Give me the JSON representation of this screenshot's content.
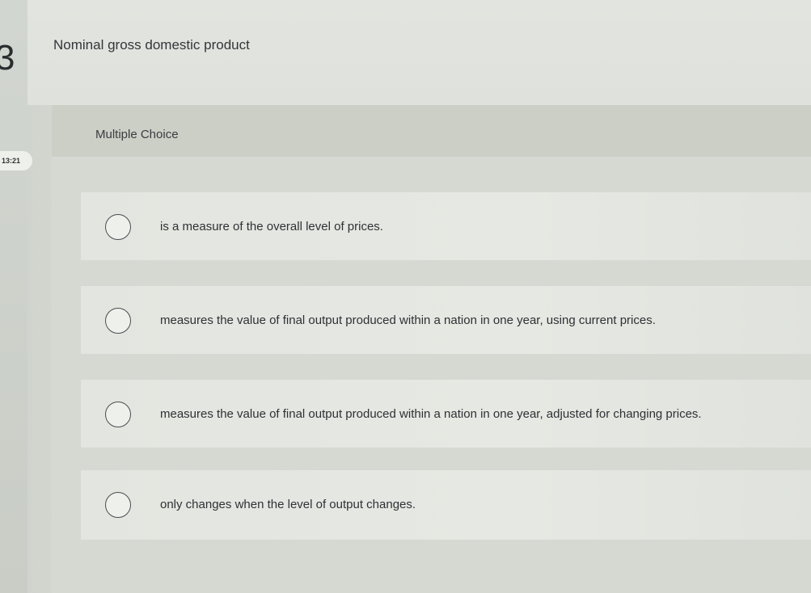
{
  "question": {
    "number": "3",
    "text": "Nominal gross domestic product",
    "timer": "13:21"
  },
  "multiple_choice": {
    "label": "Multiple Choice"
  },
  "options": [
    {
      "text": "is a measure of the overall level of prices."
    },
    {
      "text": "measures the value of final output produced within a nation in one year, using current prices."
    },
    {
      "text": "measures the value of final output produced within a nation in one year, adjusted for changing prices."
    },
    {
      "text": "only changes when the level of output changes."
    }
  ]
}
